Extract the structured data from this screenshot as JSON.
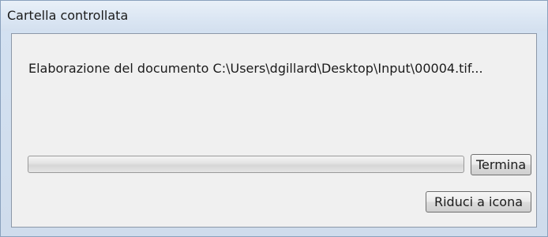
{
  "window": {
    "title": "Cartella controllata"
  },
  "main": {
    "status": "Elaborazione del documento C:\\Users\\dgillard\\Desktop\\Input\\00004.tif...",
    "progress_fraction": 0.0
  },
  "buttons": {
    "stop_label": "Termina",
    "minimize_label": "Riduci a icona"
  }
}
